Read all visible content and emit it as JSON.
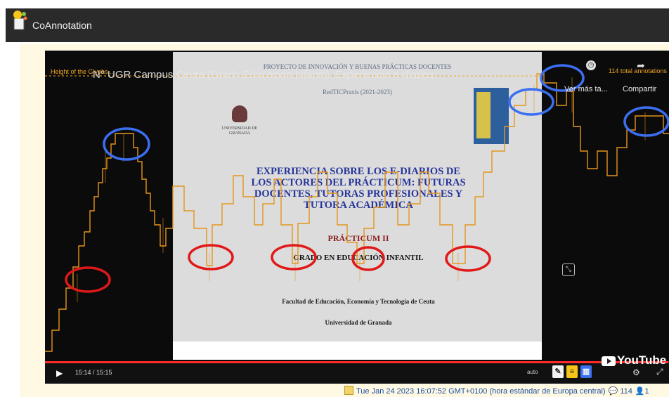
{
  "app": {
    "title": "CoAnnotation"
  },
  "video": {
    "title": "UGR Campus Ceuta (Grado Educación Infantil). Experiencia e-diarios",
    "title_prefix": "N° ",
    "height_label": "Height of the Glyphs...",
    "annotations_count": "114 total annotations",
    "ver_mas": "Ver más ta...",
    "compartir": "Compartir",
    "time": "15:14 / 15:15",
    "quality": "auto",
    "progress": 0.999,
    "youtube_label": "YouTube"
  },
  "slide": {
    "header_line1": "PROYECTO DE INNOVACIÓN Y BUENAS PRÁCTICAS DOCENTES",
    "header_line2": "RedTICPraxis (2021-2023)",
    "university_name": "UNIVERSIDAD DE GRANADA",
    "title": "EXPERIENCIA SOBRE LOS E-DIARIOS DE LOS ACTORES DEL PRÁCTICUM: FUTURAS DOCENTES, TUTORAS PROFESIONALES Y TUTORA ACADÉMICA",
    "practicum": "PRÁCTICUM II",
    "grado": "GRADO EN EDUCACIÓN INFANTIL",
    "faculty": "Facultad de Educación, Economía y Tecnología de Ceuta",
    "university": "Universidad de Granada"
  },
  "footer": {
    "timestamp": "Tue Jan 24 2023 16:07:52 GMT+0100 (hora estándar de Europa central)",
    "comments": "114",
    "users": "1"
  },
  "colors": {
    "accent": "#f5a623",
    "blue_circle": "#3b6ff2",
    "red_circle": "#e01818"
  },
  "icons": [
    "app-logo-icon",
    "clock-icon",
    "share-icon",
    "play-icon",
    "youtube-icon",
    "gear-icon",
    "fullscreen-icon"
  ]
}
